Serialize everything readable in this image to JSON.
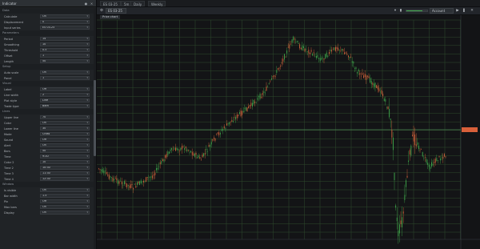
{
  "panel": {
    "title": "Indicator",
    "groups": [
      {
        "name": "Data",
        "rows": [
          {
            "label": "Calculate",
            "value": "On"
          },
          {
            "label": "Displacement",
            "value": "0"
          },
          {
            "label": "Input series",
            "value": "ES 03-25"
          }
        ]
      },
      {
        "name": "Parameters",
        "rows": [
          {
            "label": "Period",
            "value": "14"
          },
          {
            "label": "Smoothing",
            "value": "10"
          },
          {
            "label": "Threshold",
            "value": "0.5"
          },
          {
            "label": "Offset",
            "value": "1"
          },
          {
            "label": "Length",
            "value": "50"
          }
        ]
      },
      {
        "name": "Setup",
        "rows": [
          {
            "label": "Auto scale",
            "value": "On"
          },
          {
            "label": "Panel",
            "value": "1"
          }
        ]
      },
      {
        "name": "Visual",
        "rows": [
          {
            "label": "Label",
            "value": "Off"
          },
          {
            "label": "Line width",
            "value": "2"
          },
          {
            "label": "Plot style",
            "value": "Line"
          },
          {
            "label": "Trade type",
            "value": "Both"
          }
        ]
      },
      {
        "name": "Lines",
        "rows": [
          {
            "label": "Upper line",
            "value": "70"
          },
          {
            "label": "Color",
            "value": "On"
          },
          {
            "label": "Lower line",
            "value": "30"
          },
          {
            "label": "Mode",
            "value": "Cross"
          },
          {
            "label": "Sound",
            "value": "Off"
          },
          {
            "label": "Alert",
            "value": "On"
          },
          {
            "label": "Bars",
            "value": "50"
          },
          {
            "label": "Time",
            "value": "9:30"
          },
          {
            "label": "Color 2",
            "value": "10"
          },
          {
            "label": "Time 2",
            "value": "10:30"
          },
          {
            "label": "Time 3",
            "value": "11:30"
          },
          {
            "label": "Time 4",
            "value": "12:30"
          }
        ]
      },
      {
        "name": "Window",
        "rows": [
          {
            "label": "Is visible",
            "value": "On"
          },
          {
            "label": "Bar width",
            "value": "1.5"
          },
          {
            "label": "Pin",
            "value": "Off"
          },
          {
            "label": "Max bars",
            "value": "On"
          },
          {
            "label": "Display",
            "value": "On"
          }
        ]
      }
    ]
  },
  "tabs": [
    "ES 03-25",
    "5m",
    "Daily",
    "Weekly"
  ],
  "toolbar": {
    "instrument": "ES 03-25",
    "right_box": "Account",
    "progress": 0.78
  },
  "chart": {
    "name": "Price chart",
    "highlight": "",
    "price_label": "",
    "colors": {
      "up": "#3fa84b",
      "down": "#d6643c",
      "grid": "#2f4a2c",
      "level": "#5fae6b"
    }
  },
  "icons": [
    "gear-icon",
    "chevron-down-icon",
    "play-icon",
    "close-icon"
  ]
}
